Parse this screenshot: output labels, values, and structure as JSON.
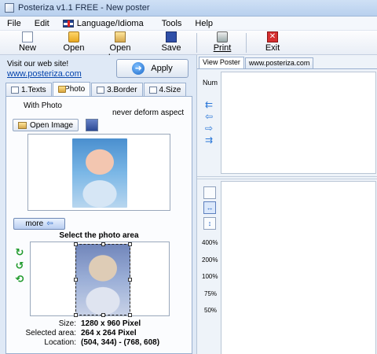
{
  "window": {
    "title": "Posteriza v1.1 FREE - New poster"
  },
  "menu": [
    "File",
    "Edit",
    "Language/Idioma",
    "Tools",
    "Help"
  ],
  "toolbar": {
    "new": "New",
    "open": "Open",
    "open_image": "Open Image",
    "save": "Save",
    "print": "Print",
    "exit": "Exit"
  },
  "left": {
    "visit_text": "Visit our web site!",
    "site_link": "www.posteriza.com",
    "apply": "Apply",
    "tabs": [
      "1.Texts",
      "2.Photo",
      "3.Border",
      "4.Size"
    ],
    "active_tab": "2.Photo",
    "with_photo": "With Photo",
    "never_deform": "never deform aspect",
    "open_image": "Open Image",
    "more": "more",
    "select_area_title": "Select the photo area",
    "info": {
      "size_label": "Size:",
      "size_value": "1280 x 960 Pixel",
      "selected_label": "Selected area:",
      "selected_value": "264 x 264 Pixel",
      "location_label": "Location:",
      "location_value": "(504, 344) - (768, 608)"
    }
  },
  "right": {
    "tabs": [
      "View Poster",
      "www.posteriza.com"
    ],
    "active_tab": "View Poster",
    "num_label": "Num",
    "zoom_levels": [
      "400%",
      "200%",
      "100%",
      "75%",
      "50%"
    ]
  }
}
